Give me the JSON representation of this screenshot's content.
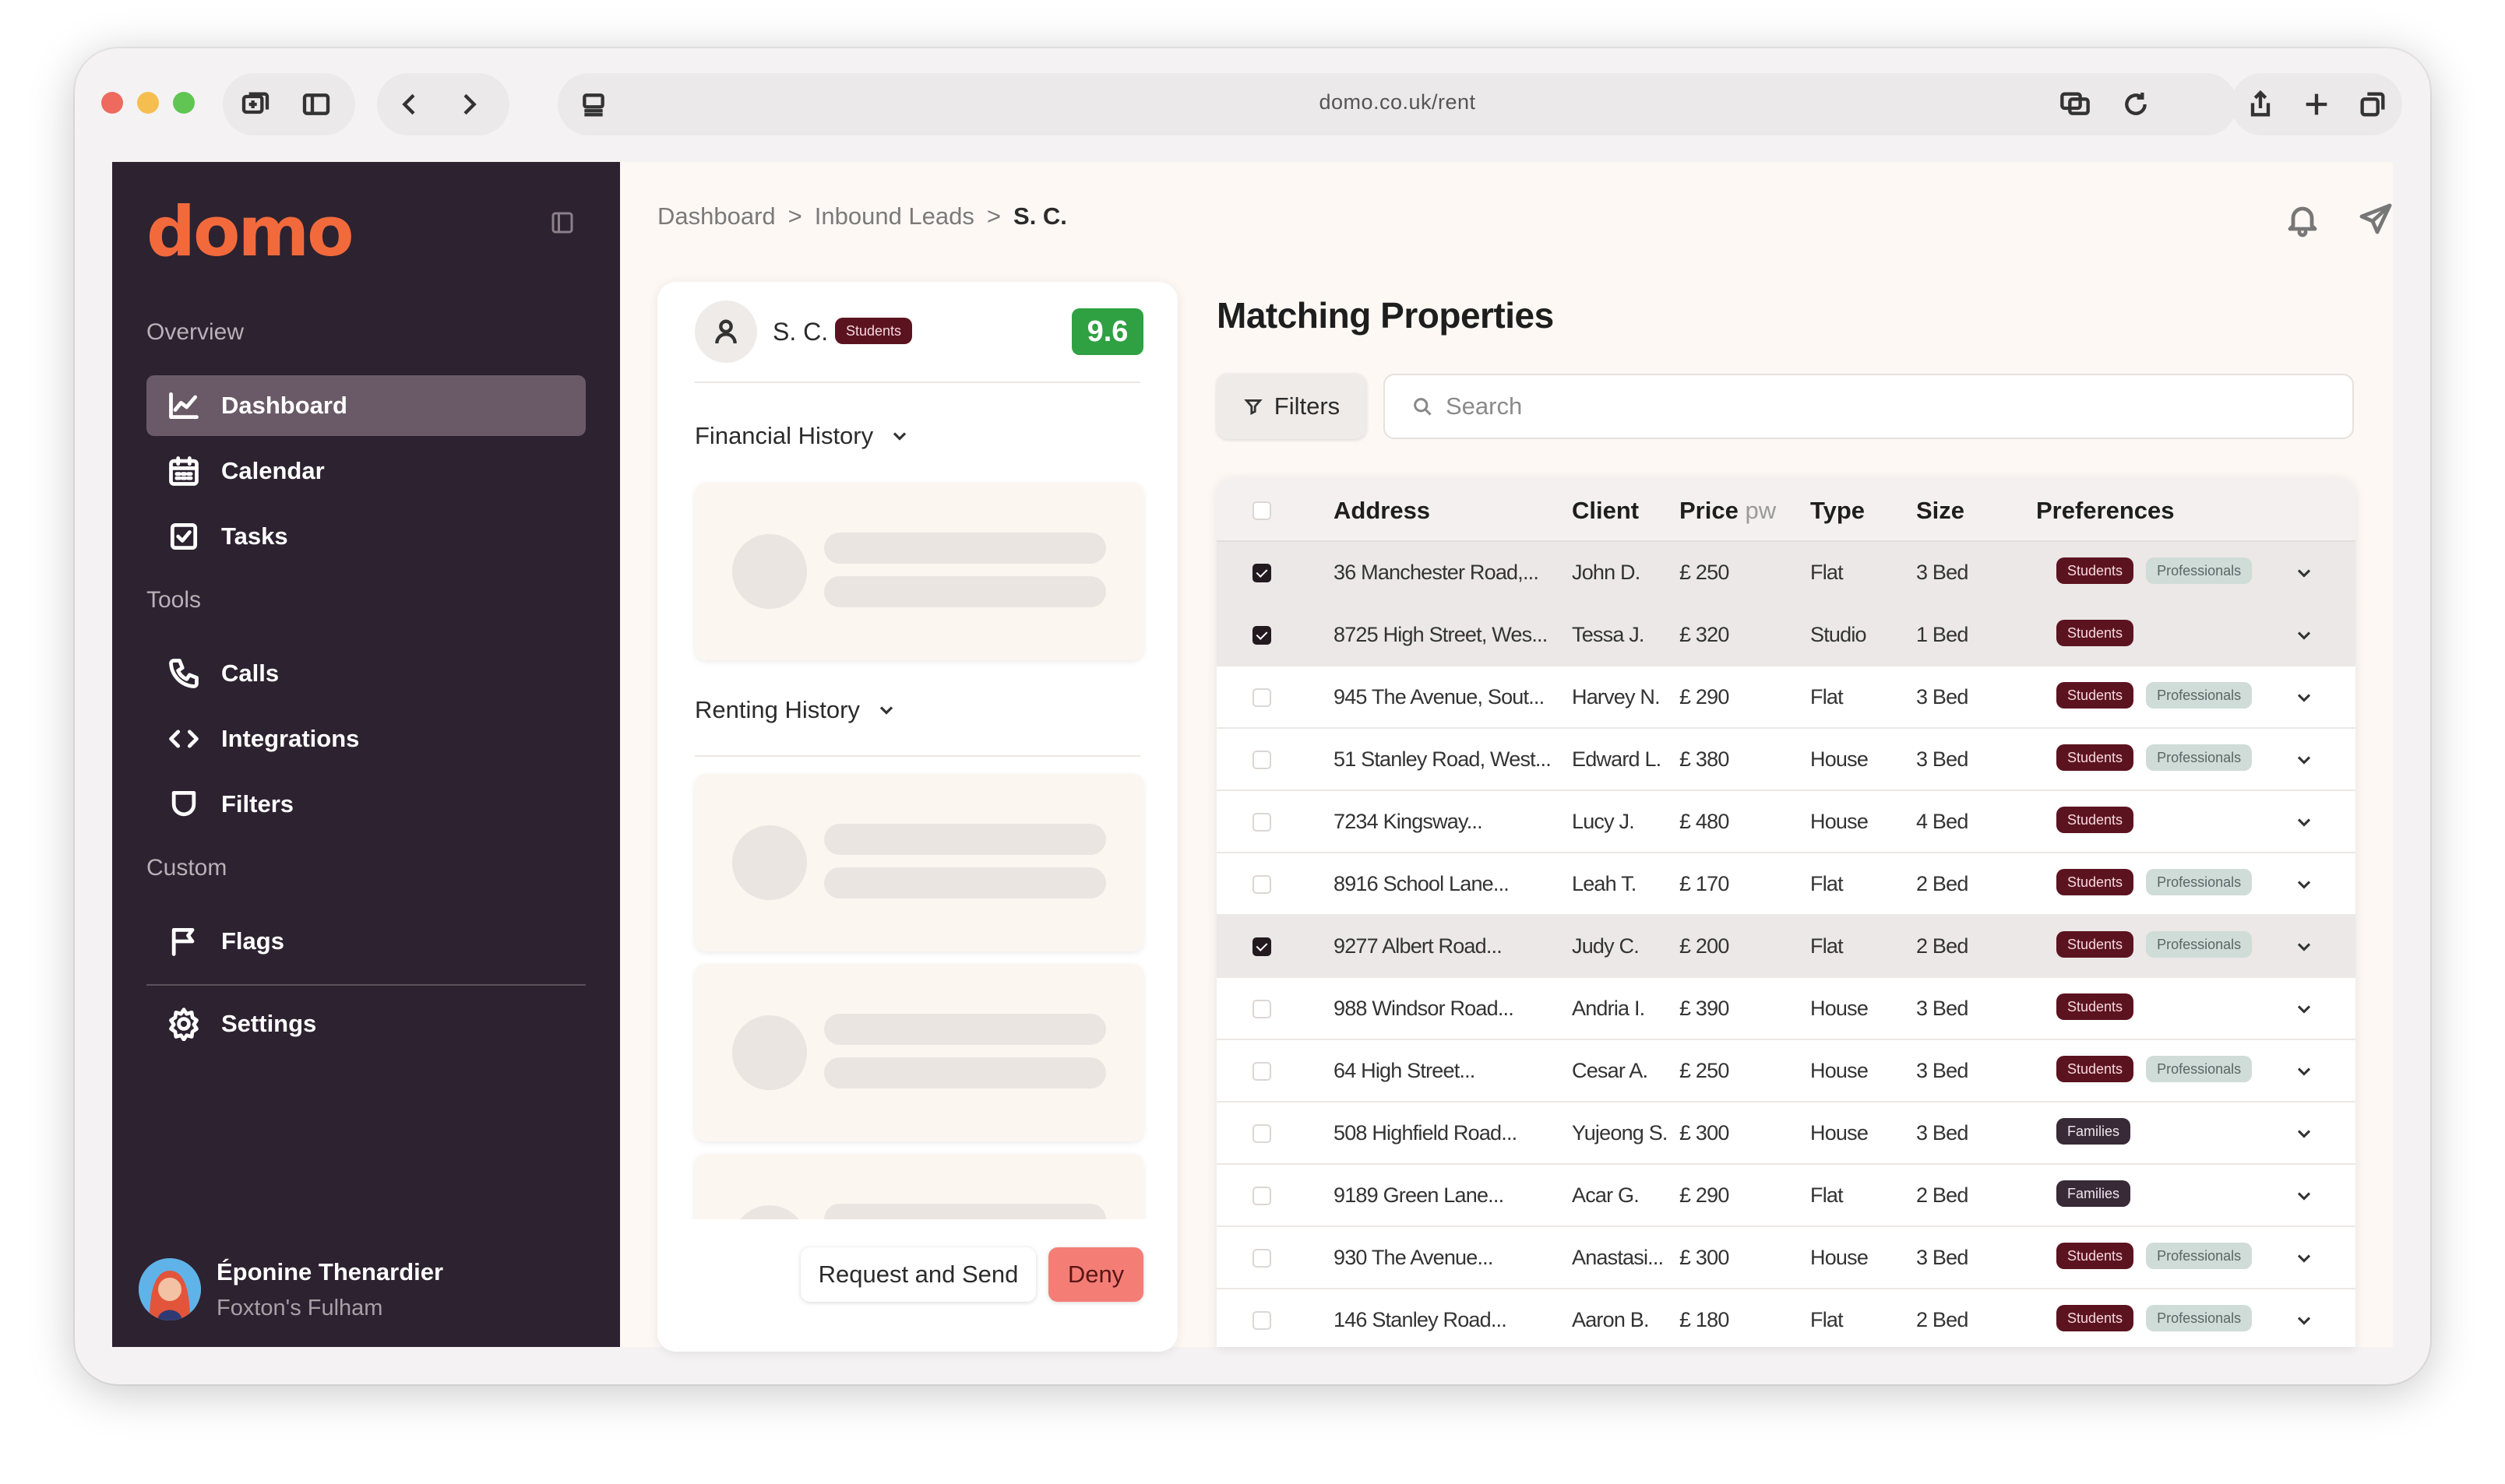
{
  "browser": {
    "url": "domo.co.uk/rent",
    "traffic_colors": [
      "#ee6a5e",
      "#f5be4f",
      "#61c554"
    ]
  },
  "sidebar": {
    "logo": "domo",
    "sections": {
      "overview": "Overview",
      "tools": "Tools",
      "custom": "Custom"
    },
    "items": [
      {
        "label": "Dashboard",
        "icon": "chart-line-icon",
        "active": true
      },
      {
        "label": "Calendar",
        "icon": "calendar-icon"
      },
      {
        "label": "Tasks",
        "icon": "checkbox-icon"
      },
      {
        "label": "Calls",
        "icon": "phone-icon"
      },
      {
        "label": "Integrations",
        "icon": "code-icon"
      },
      {
        "label": "Filters",
        "icon": "shield-icon"
      },
      {
        "label": "Flags",
        "icon": "flag-icon"
      },
      {
        "label": "Settings",
        "icon": "gear-icon"
      }
    ],
    "user": {
      "name": "Éponine Thenardier",
      "org": "Foxton's Fulham"
    }
  },
  "breadcrumb": {
    "items": [
      "Dashboard",
      "Inbound Leads"
    ],
    "separator": ">",
    "current": "S. C."
  },
  "lead": {
    "name": "S. C.",
    "badge": "Students",
    "score": "9.6",
    "financial_history": "Financial History",
    "renting_history": "Renting History",
    "request_button": "Request and Send",
    "deny_button": "Deny"
  },
  "properties": {
    "title": "Matching Properties",
    "filters_label": "Filters",
    "search_placeholder": "Search",
    "columns": {
      "address": "Address",
      "client": "Client",
      "price": "Price",
      "price_unit": "pw",
      "type": "Type",
      "size": "Size",
      "preferences": "Preferences"
    },
    "rows": [
      {
        "checked": true,
        "address": "36 Manchester Road,...",
        "client": "John D.",
        "price": "£ 250",
        "type": "Flat",
        "size": "3 Bed",
        "prefs": [
          "Students",
          "Professionals"
        ]
      },
      {
        "checked": true,
        "address": "8725 High Street, Wes...",
        "client": "Tessa J.",
        "price": "£ 320",
        "type": "Studio",
        "size": "1 Bed",
        "prefs": [
          "Students"
        ]
      },
      {
        "checked": false,
        "address": "945 The Avenue, Sout...",
        "client": "Harvey N.",
        "price": "£ 290",
        "type": "Flat",
        "size": "3 Bed",
        "prefs": [
          "Students",
          "Professionals"
        ]
      },
      {
        "checked": false,
        "address": "51 Stanley Road, West...",
        "client": "Edward L.",
        "price": "£ 380",
        "type": "House",
        "size": "3 Bed",
        "prefs": [
          "Students",
          "Professionals"
        ]
      },
      {
        "checked": false,
        "address": "7234 Kingsway...",
        "client": "Lucy J.",
        "price": "£ 480",
        "type": "House",
        "size": "4 Bed",
        "prefs": [
          "Students"
        ]
      },
      {
        "checked": false,
        "address": "8916 School Lane...",
        "client": "Leah T.",
        "price": "£ 170",
        "type": "Flat",
        "size": "2 Bed",
        "prefs": [
          "Students",
          "Professionals"
        ]
      },
      {
        "checked": true,
        "address": "9277 Albert Road...",
        "client": "Judy C.",
        "price": "£ 200",
        "type": "Flat",
        "size": "2 Bed",
        "prefs": [
          "Students",
          "Professionals"
        ]
      },
      {
        "checked": false,
        "address": "988 Windsor Road...",
        "client": "Andria I.",
        "price": "£ 390",
        "type": "House",
        "size": "3 Bed",
        "prefs": [
          "Students"
        ]
      },
      {
        "checked": false,
        "address": "64 High Street...",
        "client": "Cesar A.",
        "price": "£ 250",
        "type": "House",
        "size": "3 Bed",
        "prefs": [
          "Students",
          "Professionals"
        ]
      },
      {
        "checked": false,
        "address": "508 Highfield Road...",
        "client": "Yujeong S.",
        "price": "£ 300",
        "type": "House",
        "size": "3 Bed",
        "prefs": [
          "Families"
        ]
      },
      {
        "checked": false,
        "address": "9189 Green Lane...",
        "client": "Acar G.",
        "price": "£ 290",
        "type": "Flat",
        "size": "2 Bed",
        "prefs": [
          "Families"
        ]
      },
      {
        "checked": false,
        "address": "930 The Avenue...",
        "client": "Anastasi...",
        "price": "£ 300",
        "type": "House",
        "size": "3 Bed",
        "prefs": [
          "Students",
          "Professionals"
        ]
      },
      {
        "checked": false,
        "address": "146 Stanley Road...",
        "client": "Aaron B.",
        "price": "£ 180",
        "type": "Flat",
        "size": "2 Bed",
        "prefs": [
          "Students",
          "Professionals"
        ]
      }
    ]
  },
  "colors": {
    "sidebar_bg": "#2d2230",
    "brand": "#f26a3c",
    "students_badge": "#5c1320",
    "professionals_badge": "#cfdcd8",
    "families_badge": "#382a36",
    "score_bg": "#2fa142",
    "deny_bg": "#f47e76"
  }
}
